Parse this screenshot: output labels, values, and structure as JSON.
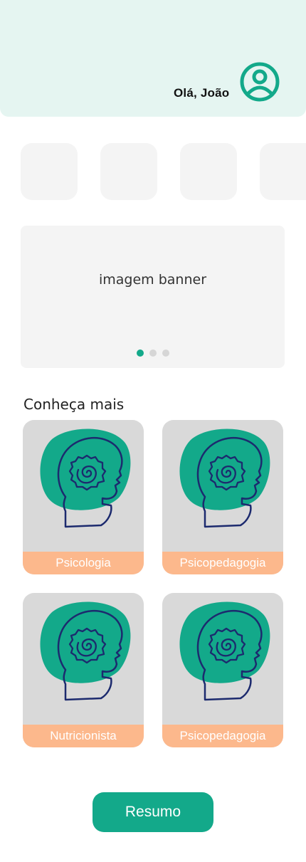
{
  "header": {
    "greeting": "Olá, João",
    "avatar_icon": "user-circle-icon"
  },
  "quick_actions": {
    "count_visible": 4
  },
  "banner": {
    "text": "imagem banner",
    "dots": 3,
    "active_dot": 0
  },
  "section": {
    "title": "Conheça mais",
    "cards": [
      {
        "label": "Psicologia",
        "icon": "mind-head-icon"
      },
      {
        "label": "Psicopedagogia",
        "icon": "mind-head-icon"
      },
      {
        "label": "Nutricionista",
        "icon": "mind-head-icon"
      },
      {
        "label": "Psicopedagogia",
        "icon": "mind-head-icon"
      }
    ]
  },
  "footer": {
    "resumo_label": "Resumo"
  },
  "colors": {
    "primary": "#13a98a",
    "header_bg": "#e5f5f1",
    "card_bg": "#d9d9d9",
    "card_label_bg": "#fcb88c",
    "placeholder_bg": "#f4f4f4",
    "head_stroke": "#1c2a6e"
  }
}
